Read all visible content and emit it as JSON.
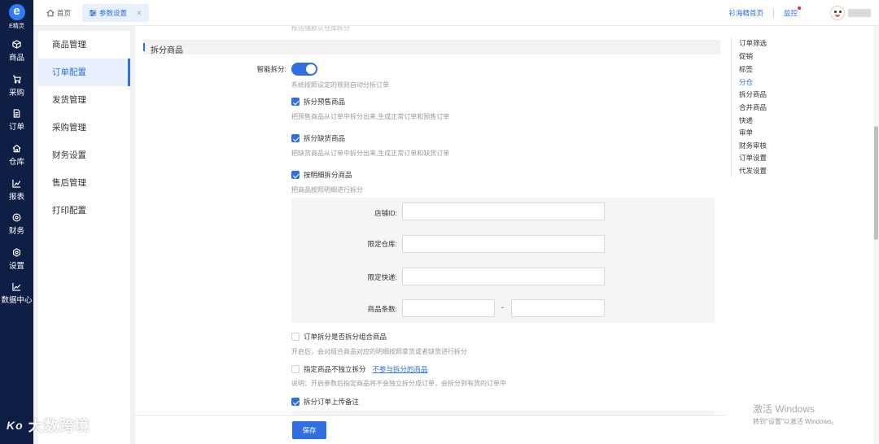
{
  "rail": {
    "logo_letter": "e",
    "logo_text": "E精灵",
    "items": [
      {
        "label": "商品",
        "icon": "cube-icon"
      },
      {
        "label": "采购",
        "icon": "cart-icon"
      },
      {
        "label": "订单",
        "icon": "document-icon"
      },
      {
        "label": "仓库",
        "icon": "house-icon"
      },
      {
        "label": "报表",
        "icon": "chart-icon"
      },
      {
        "label": "财务",
        "icon": "coin-icon"
      },
      {
        "label": "设置",
        "icon": "gear-icon"
      },
      {
        "label": "数据中心",
        "icon": "trend-icon"
      }
    ]
  },
  "topbar": {
    "tab_home": "首页",
    "tab_params": "参数设置",
    "tab_close": "×",
    "link_shop": "衫海精首页",
    "link_monitor": "监控"
  },
  "submenu": {
    "items": [
      "商品管理",
      "订单配置",
      "发货管理",
      "采购管理",
      "财务设置",
      "售后管理",
      "打印配置"
    ],
    "active": "订单配置"
  },
  "main": {
    "cut_text": "按店铺默认仓库拆分",
    "section_title": "拆分商品",
    "smart_split_label": "智能拆分:",
    "smart_split_on": true,
    "smart_split_hint": "系统按照设定的规则自动分拆订单",
    "opt_presale": "拆分预售商品",
    "opt_presale_hint": "把预售商品从订单中拆分出来,生成正常订单和预售订单",
    "opt_outofstock": "拆分缺货商品",
    "opt_outofstock_hint": "把缺货商品从订单中拆分出来,生成正常订单和缺货订单",
    "opt_detail": "按明细拆分商品",
    "opt_detail_hint": "把商品按照明细进行拆分",
    "filter": {
      "shop_id": "店铺ID:",
      "warehouse": "限定仓库:",
      "express": "限定快递:",
      "item_count": "商品条数:",
      "dash": "-"
    },
    "opt_combo": "订单拆分是否拆分组合商品",
    "opt_combo_hint": "开启后，会对组合商品对应的明细按照拿货或者缺货进行拆分",
    "opt_independent": "指定商品不独立拆分",
    "opt_independent_link": "不参与拆分的商品",
    "opt_independent_hint": "说明：开启参数后指定商品将不会独立拆分成订单，会拆分到有货的订单中",
    "opt_upload_remark": "拆分订单上传备注",
    "save": "保存"
  },
  "anchor": {
    "items": [
      "订单筛选",
      "促销",
      "标签",
      "分仓",
      "拆分商品",
      "合并商品",
      "快递",
      "审单",
      "财务审核",
      "订单设置",
      "代发设置"
    ],
    "active": "分仓"
  },
  "os": {
    "activate_title": "激活 Windows",
    "activate_sub": "转到\"设置\"以激活 Windows。"
  },
  "watermark": {
    "mark": "Ko",
    "text": "大数跨境"
  }
}
